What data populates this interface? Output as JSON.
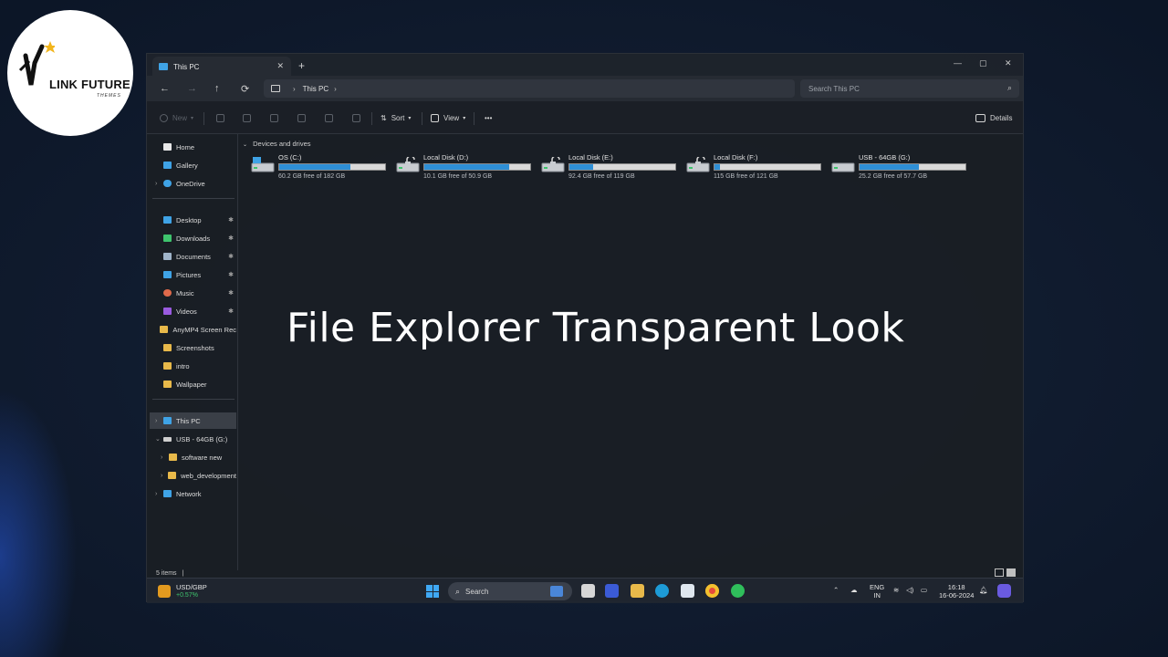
{
  "logo": {
    "title": "LINK FUTURE",
    "subtitle": "THEMES"
  },
  "window": {
    "tab_title": "This PC",
    "tab_close": "✕",
    "new_tab": "+",
    "controls": {
      "minimize": "—",
      "maximize": "▢",
      "close": "✕"
    }
  },
  "nav": {
    "back": "←",
    "forward": "→",
    "up": "↑",
    "refresh": "⟳",
    "address": {
      "location": "This PC",
      "chevron": "›",
      "chevron_end": "›"
    },
    "search_placeholder": "Search This PC",
    "search_icon": "⌕"
  },
  "toolbar": {
    "new_label": "New",
    "sort_label": "Sort",
    "view_label": "View",
    "more_label": "•••",
    "details_label": "Details"
  },
  "sidebar": {
    "items": [
      {
        "label": "Home",
        "icon": "home-icon",
        "color": "#e8e8e8"
      },
      {
        "label": "Gallery",
        "icon": "gallery-icon",
        "color": "#3fa3e6"
      },
      {
        "label": "OneDrive",
        "icon": "onedrive-icon",
        "color": "#3fa3e6"
      },
      {
        "label": "Desktop",
        "icon": "desktop-folder-icon",
        "color": "#3fa3e6",
        "pinned": true
      },
      {
        "label": "Downloads",
        "icon": "downloads-icon",
        "color": "#3ec46d",
        "pinned": true
      },
      {
        "label": "Documents",
        "icon": "documents-icon",
        "color": "#9fb4c9",
        "pinned": true
      },
      {
        "label": "Pictures",
        "icon": "pictures-icon",
        "color": "#3fa3e6",
        "pinned": true
      },
      {
        "label": "Music",
        "icon": "music-icon",
        "color": "#e06a4b",
        "pinned": true
      },
      {
        "label": "Videos",
        "icon": "videos-icon",
        "color": "#9a5be0",
        "pinned": true
      },
      {
        "label": "AnyMP4 Screen Rec",
        "icon": "folder-icon",
        "color": "#e8b94a"
      },
      {
        "label": "Screenshots",
        "icon": "folder-icon",
        "color": "#e8b94a"
      },
      {
        "label": "intro",
        "icon": "folder-icon",
        "color": "#e8b94a"
      },
      {
        "label": "Wallpaper",
        "icon": "folder-icon",
        "color": "#e8b94a"
      },
      {
        "label": "This PC",
        "icon": "this-pc-icon",
        "color": "#3fa3e6"
      },
      {
        "label": "USB - 64GB (G:)",
        "icon": "usb-drive-icon",
        "color": "#cfcfcf"
      },
      {
        "label": "software new",
        "icon": "folder-icon",
        "color": "#e8b94a"
      },
      {
        "label": "web_development",
        "icon": "folder-icon",
        "color": "#e8b94a"
      },
      {
        "label": "Network",
        "icon": "network-icon",
        "color": "#3fa3e6"
      }
    ],
    "pin_glyph": "📌",
    "expand_glyph": "›",
    "expanded_glyph": "⌄"
  },
  "content": {
    "group_title": "Devices and drives",
    "drives": [
      {
        "name": "OS (C:)",
        "free_text": "60.2 GB free of 182 GB",
        "used_fraction": 0.67,
        "icon": "windows-drive-icon"
      },
      {
        "name": "Local Disk (D:)",
        "free_text": "10.1 GB free of 50.9 GB",
        "used_fraction": 0.8,
        "icon": "unlocked-drive-icon"
      },
      {
        "name": "Local Disk (E:)",
        "free_text": "92.4 GB free of 119 GB",
        "used_fraction": 0.22,
        "icon": "unlocked-drive-icon"
      },
      {
        "name": "Local Disk (F:)",
        "free_text": "115 GB free of 121 GB",
        "used_fraction": 0.05,
        "icon": "unlocked-drive-icon"
      },
      {
        "name": "USB - 64GB (G:)",
        "free_text": "25.2 GB free of 57.7 GB",
        "used_fraction": 0.56,
        "icon": "usb-drive-icon"
      }
    ]
  },
  "status": {
    "items": "5 items",
    "divider": "|"
  },
  "taskbar": {
    "stock_symbol": "USD/GBP",
    "stock_change": "+0.57%",
    "search_label": "Search",
    "language": "ENG",
    "region": "IN",
    "time": "16:18",
    "date": "16-06-2024"
  },
  "overlay": {
    "title": "File Explorer Transparent Look"
  },
  "colors": {
    "accent": "#2e8fd6",
    "background": "#0f1a2c"
  }
}
